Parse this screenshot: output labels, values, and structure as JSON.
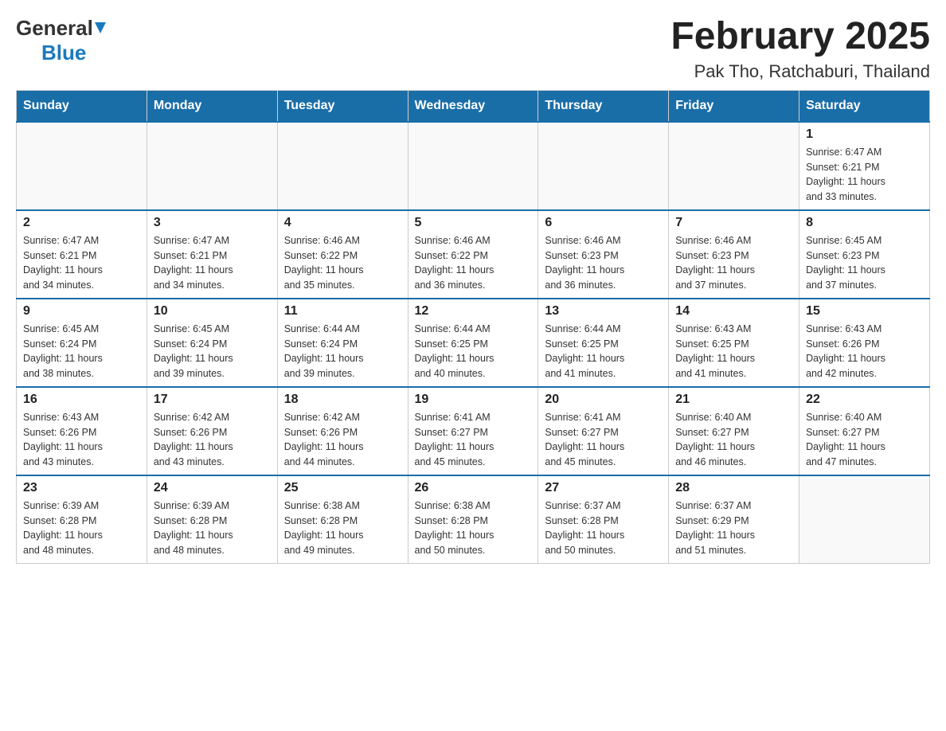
{
  "logo": {
    "general_text": "General",
    "blue_text": "Blue"
  },
  "header": {
    "month_year": "February 2025",
    "location": "Pak Tho, Ratchaburi, Thailand"
  },
  "weekdays": [
    "Sunday",
    "Monday",
    "Tuesday",
    "Wednesday",
    "Thursday",
    "Friday",
    "Saturday"
  ],
  "weeks": [
    {
      "days": [
        {
          "number": "",
          "info": ""
        },
        {
          "number": "",
          "info": ""
        },
        {
          "number": "",
          "info": ""
        },
        {
          "number": "",
          "info": ""
        },
        {
          "number": "",
          "info": ""
        },
        {
          "number": "",
          "info": ""
        },
        {
          "number": "1",
          "info": "Sunrise: 6:47 AM\nSunset: 6:21 PM\nDaylight: 11 hours\nand 33 minutes."
        }
      ]
    },
    {
      "days": [
        {
          "number": "2",
          "info": "Sunrise: 6:47 AM\nSunset: 6:21 PM\nDaylight: 11 hours\nand 34 minutes."
        },
        {
          "number": "3",
          "info": "Sunrise: 6:47 AM\nSunset: 6:21 PM\nDaylight: 11 hours\nand 34 minutes."
        },
        {
          "number": "4",
          "info": "Sunrise: 6:46 AM\nSunset: 6:22 PM\nDaylight: 11 hours\nand 35 minutes."
        },
        {
          "number": "5",
          "info": "Sunrise: 6:46 AM\nSunset: 6:22 PM\nDaylight: 11 hours\nand 36 minutes."
        },
        {
          "number": "6",
          "info": "Sunrise: 6:46 AM\nSunset: 6:23 PM\nDaylight: 11 hours\nand 36 minutes."
        },
        {
          "number": "7",
          "info": "Sunrise: 6:46 AM\nSunset: 6:23 PM\nDaylight: 11 hours\nand 37 minutes."
        },
        {
          "number": "8",
          "info": "Sunrise: 6:45 AM\nSunset: 6:23 PM\nDaylight: 11 hours\nand 37 minutes."
        }
      ]
    },
    {
      "days": [
        {
          "number": "9",
          "info": "Sunrise: 6:45 AM\nSunset: 6:24 PM\nDaylight: 11 hours\nand 38 minutes."
        },
        {
          "number": "10",
          "info": "Sunrise: 6:45 AM\nSunset: 6:24 PM\nDaylight: 11 hours\nand 39 minutes."
        },
        {
          "number": "11",
          "info": "Sunrise: 6:44 AM\nSunset: 6:24 PM\nDaylight: 11 hours\nand 39 minutes."
        },
        {
          "number": "12",
          "info": "Sunrise: 6:44 AM\nSunset: 6:25 PM\nDaylight: 11 hours\nand 40 minutes."
        },
        {
          "number": "13",
          "info": "Sunrise: 6:44 AM\nSunset: 6:25 PM\nDaylight: 11 hours\nand 41 minutes."
        },
        {
          "number": "14",
          "info": "Sunrise: 6:43 AM\nSunset: 6:25 PM\nDaylight: 11 hours\nand 41 minutes."
        },
        {
          "number": "15",
          "info": "Sunrise: 6:43 AM\nSunset: 6:26 PM\nDaylight: 11 hours\nand 42 minutes."
        }
      ]
    },
    {
      "days": [
        {
          "number": "16",
          "info": "Sunrise: 6:43 AM\nSunset: 6:26 PM\nDaylight: 11 hours\nand 43 minutes."
        },
        {
          "number": "17",
          "info": "Sunrise: 6:42 AM\nSunset: 6:26 PM\nDaylight: 11 hours\nand 43 minutes."
        },
        {
          "number": "18",
          "info": "Sunrise: 6:42 AM\nSunset: 6:26 PM\nDaylight: 11 hours\nand 44 minutes."
        },
        {
          "number": "19",
          "info": "Sunrise: 6:41 AM\nSunset: 6:27 PM\nDaylight: 11 hours\nand 45 minutes."
        },
        {
          "number": "20",
          "info": "Sunrise: 6:41 AM\nSunset: 6:27 PM\nDaylight: 11 hours\nand 45 minutes."
        },
        {
          "number": "21",
          "info": "Sunrise: 6:40 AM\nSunset: 6:27 PM\nDaylight: 11 hours\nand 46 minutes."
        },
        {
          "number": "22",
          "info": "Sunrise: 6:40 AM\nSunset: 6:27 PM\nDaylight: 11 hours\nand 47 minutes."
        }
      ]
    },
    {
      "days": [
        {
          "number": "23",
          "info": "Sunrise: 6:39 AM\nSunset: 6:28 PM\nDaylight: 11 hours\nand 48 minutes."
        },
        {
          "number": "24",
          "info": "Sunrise: 6:39 AM\nSunset: 6:28 PM\nDaylight: 11 hours\nand 48 minutes."
        },
        {
          "number": "25",
          "info": "Sunrise: 6:38 AM\nSunset: 6:28 PM\nDaylight: 11 hours\nand 49 minutes."
        },
        {
          "number": "26",
          "info": "Sunrise: 6:38 AM\nSunset: 6:28 PM\nDaylight: 11 hours\nand 50 minutes."
        },
        {
          "number": "27",
          "info": "Sunrise: 6:37 AM\nSunset: 6:28 PM\nDaylight: 11 hours\nand 50 minutes."
        },
        {
          "number": "28",
          "info": "Sunrise: 6:37 AM\nSunset: 6:29 PM\nDaylight: 11 hours\nand 51 minutes."
        },
        {
          "number": "",
          "info": ""
        }
      ]
    }
  ]
}
